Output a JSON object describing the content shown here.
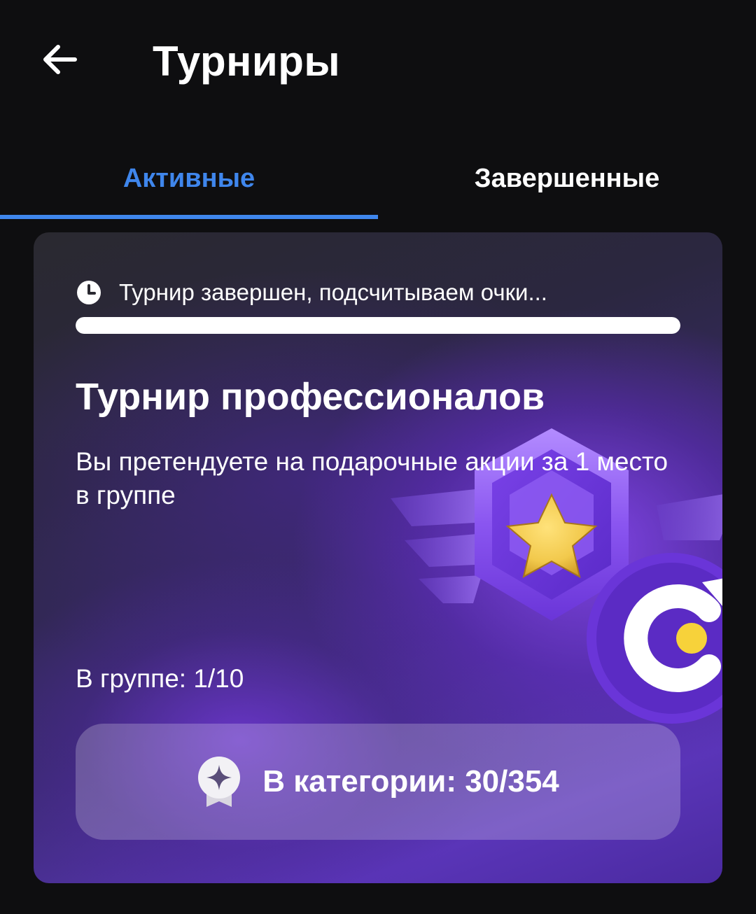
{
  "header": {
    "title": "Турниры",
    "back_icon": "arrow-left-icon"
  },
  "tabs": [
    {
      "label": "Активные",
      "active": true
    },
    {
      "label": "Завершенные",
      "active": false
    }
  ],
  "colors": {
    "accent": "#3f86ec",
    "background": "#0e0e10",
    "card_purple": "#5a35b8",
    "medal_gold": "#f2c94c"
  },
  "card": {
    "status_icon": "clock-icon",
    "status_text": "Турнир завершен, подсчитываем очки...",
    "progress": 1.0,
    "title": "Турнир профессионалов",
    "description": "Вы претендуете на подарочные акции за 1 место в группе",
    "group_text": "В группе: 1/10",
    "category_icon": "award-medal-icon",
    "category_text": "В категории: 30/354",
    "illustration_icon": "star-badge-illustration"
  }
}
